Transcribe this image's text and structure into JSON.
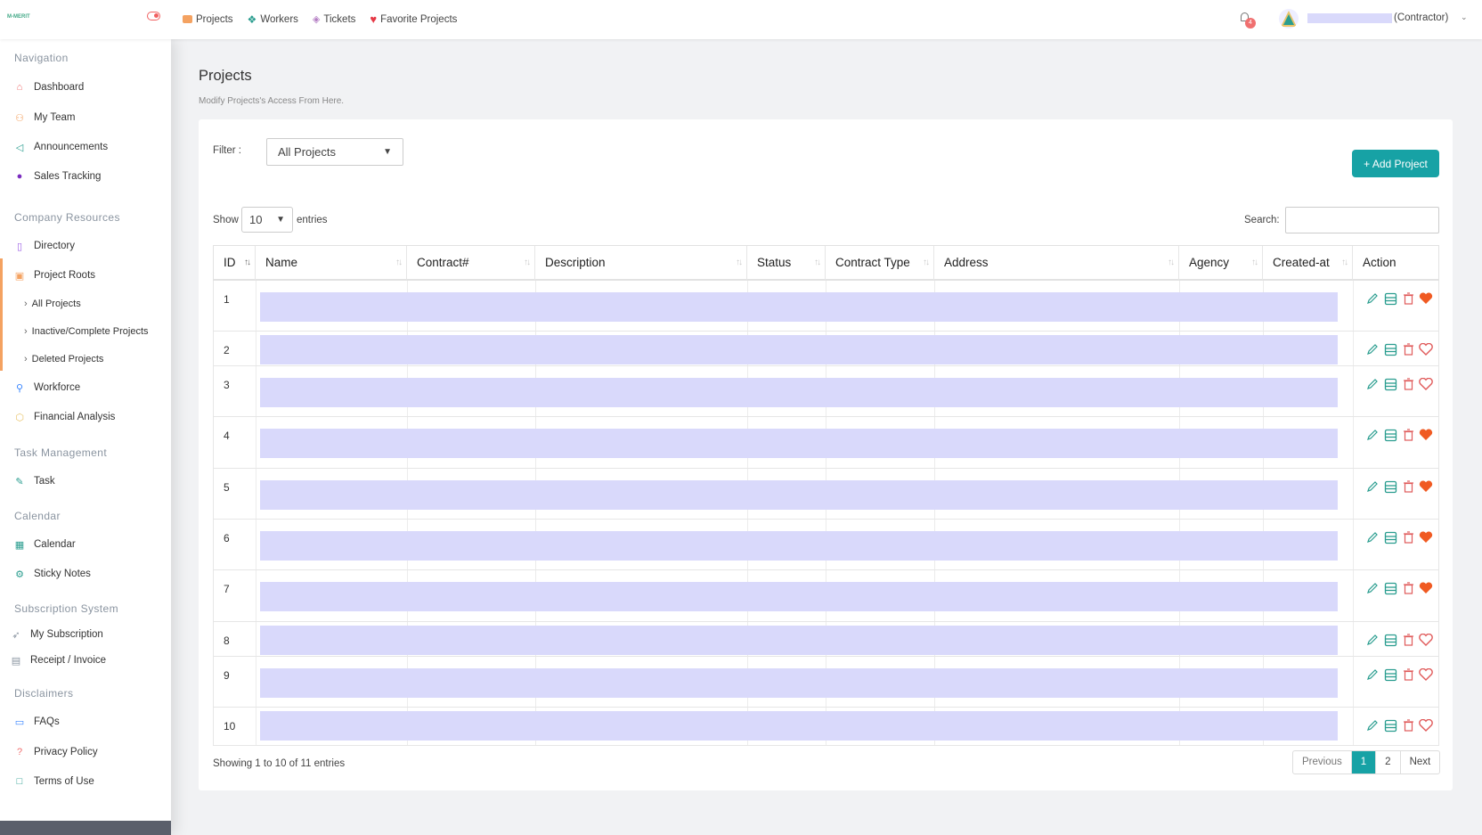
{
  "topbar": {
    "logo": "M-MERIT",
    "nav": [
      {
        "label": "Projects",
        "icon": "folder-icon"
      },
      {
        "label": "Workers",
        "icon": "paw-icon"
      },
      {
        "label": "Tickets",
        "icon": "ticket-icon"
      },
      {
        "label": "Favorite Projects",
        "icon": "heart-icon"
      }
    ],
    "notification_count": "4",
    "user_role": "(Contractor)"
  },
  "sidebar": {
    "sections": {
      "navigation": "Navigation",
      "company": "Company Resources",
      "task": "Task Management",
      "calendar": "Calendar",
      "subscription": "Subscription System",
      "disclaimers": "Disclaimers"
    },
    "items": {
      "dashboard": "Dashboard",
      "my_team": "My Team",
      "announcements": "Announcements",
      "sales_tracking": "Sales Tracking",
      "directory": "Directory",
      "project_roots": "Project Roots",
      "all_projects": "All Projects",
      "inactive_projects": "Inactive/Complete Projects",
      "deleted_projects": "Deleted Projects",
      "workforce": "Workforce",
      "financial": "Financial Analysis",
      "task": "Task",
      "calendar": "Calendar",
      "sticky_notes": "Sticky Notes",
      "my_subscription": "My Subscription",
      "receipt": "Receipt / Invoice",
      "faqs": "FAQs",
      "privacy": "Privacy Policy",
      "terms": "Terms of Use"
    }
  },
  "page": {
    "title": "Projects",
    "subtitle": "Modify Projects's Access From Here."
  },
  "filter": {
    "label": "Filter :",
    "selected": "All Projects"
  },
  "add_button": "+ Add Project",
  "table_controls": {
    "show_label": "Show",
    "show_value": "10",
    "entries_label": "entries",
    "search_label": "Search:",
    "search_value": ""
  },
  "columns": [
    "ID",
    "Name",
    "Contract#",
    "Description",
    "Status",
    "Contract Type",
    "Address",
    "Agency",
    "Created-at",
    "Action"
  ],
  "rows": [
    {
      "id": "1",
      "favorite": true
    },
    {
      "id": "2",
      "favorite": false
    },
    {
      "id": "3",
      "favorite": false
    },
    {
      "id": "4",
      "favorite": true
    },
    {
      "id": "5",
      "favorite": true
    },
    {
      "id": "6",
      "favorite": true
    },
    {
      "id": "7",
      "favorite": true
    },
    {
      "id": "8",
      "favorite": false
    },
    {
      "id": "9",
      "favorite": false
    },
    {
      "id": "10",
      "favorite": false
    }
  ],
  "footer": {
    "showing": "Showing 1 to 10 of 11 entries",
    "prev": "Previous",
    "pages": [
      "1",
      "2"
    ],
    "next": "Next"
  },
  "colors": {
    "accent": "#17a2a5",
    "redaction": "#d9d9fb",
    "heart": "#f05a22"
  }
}
